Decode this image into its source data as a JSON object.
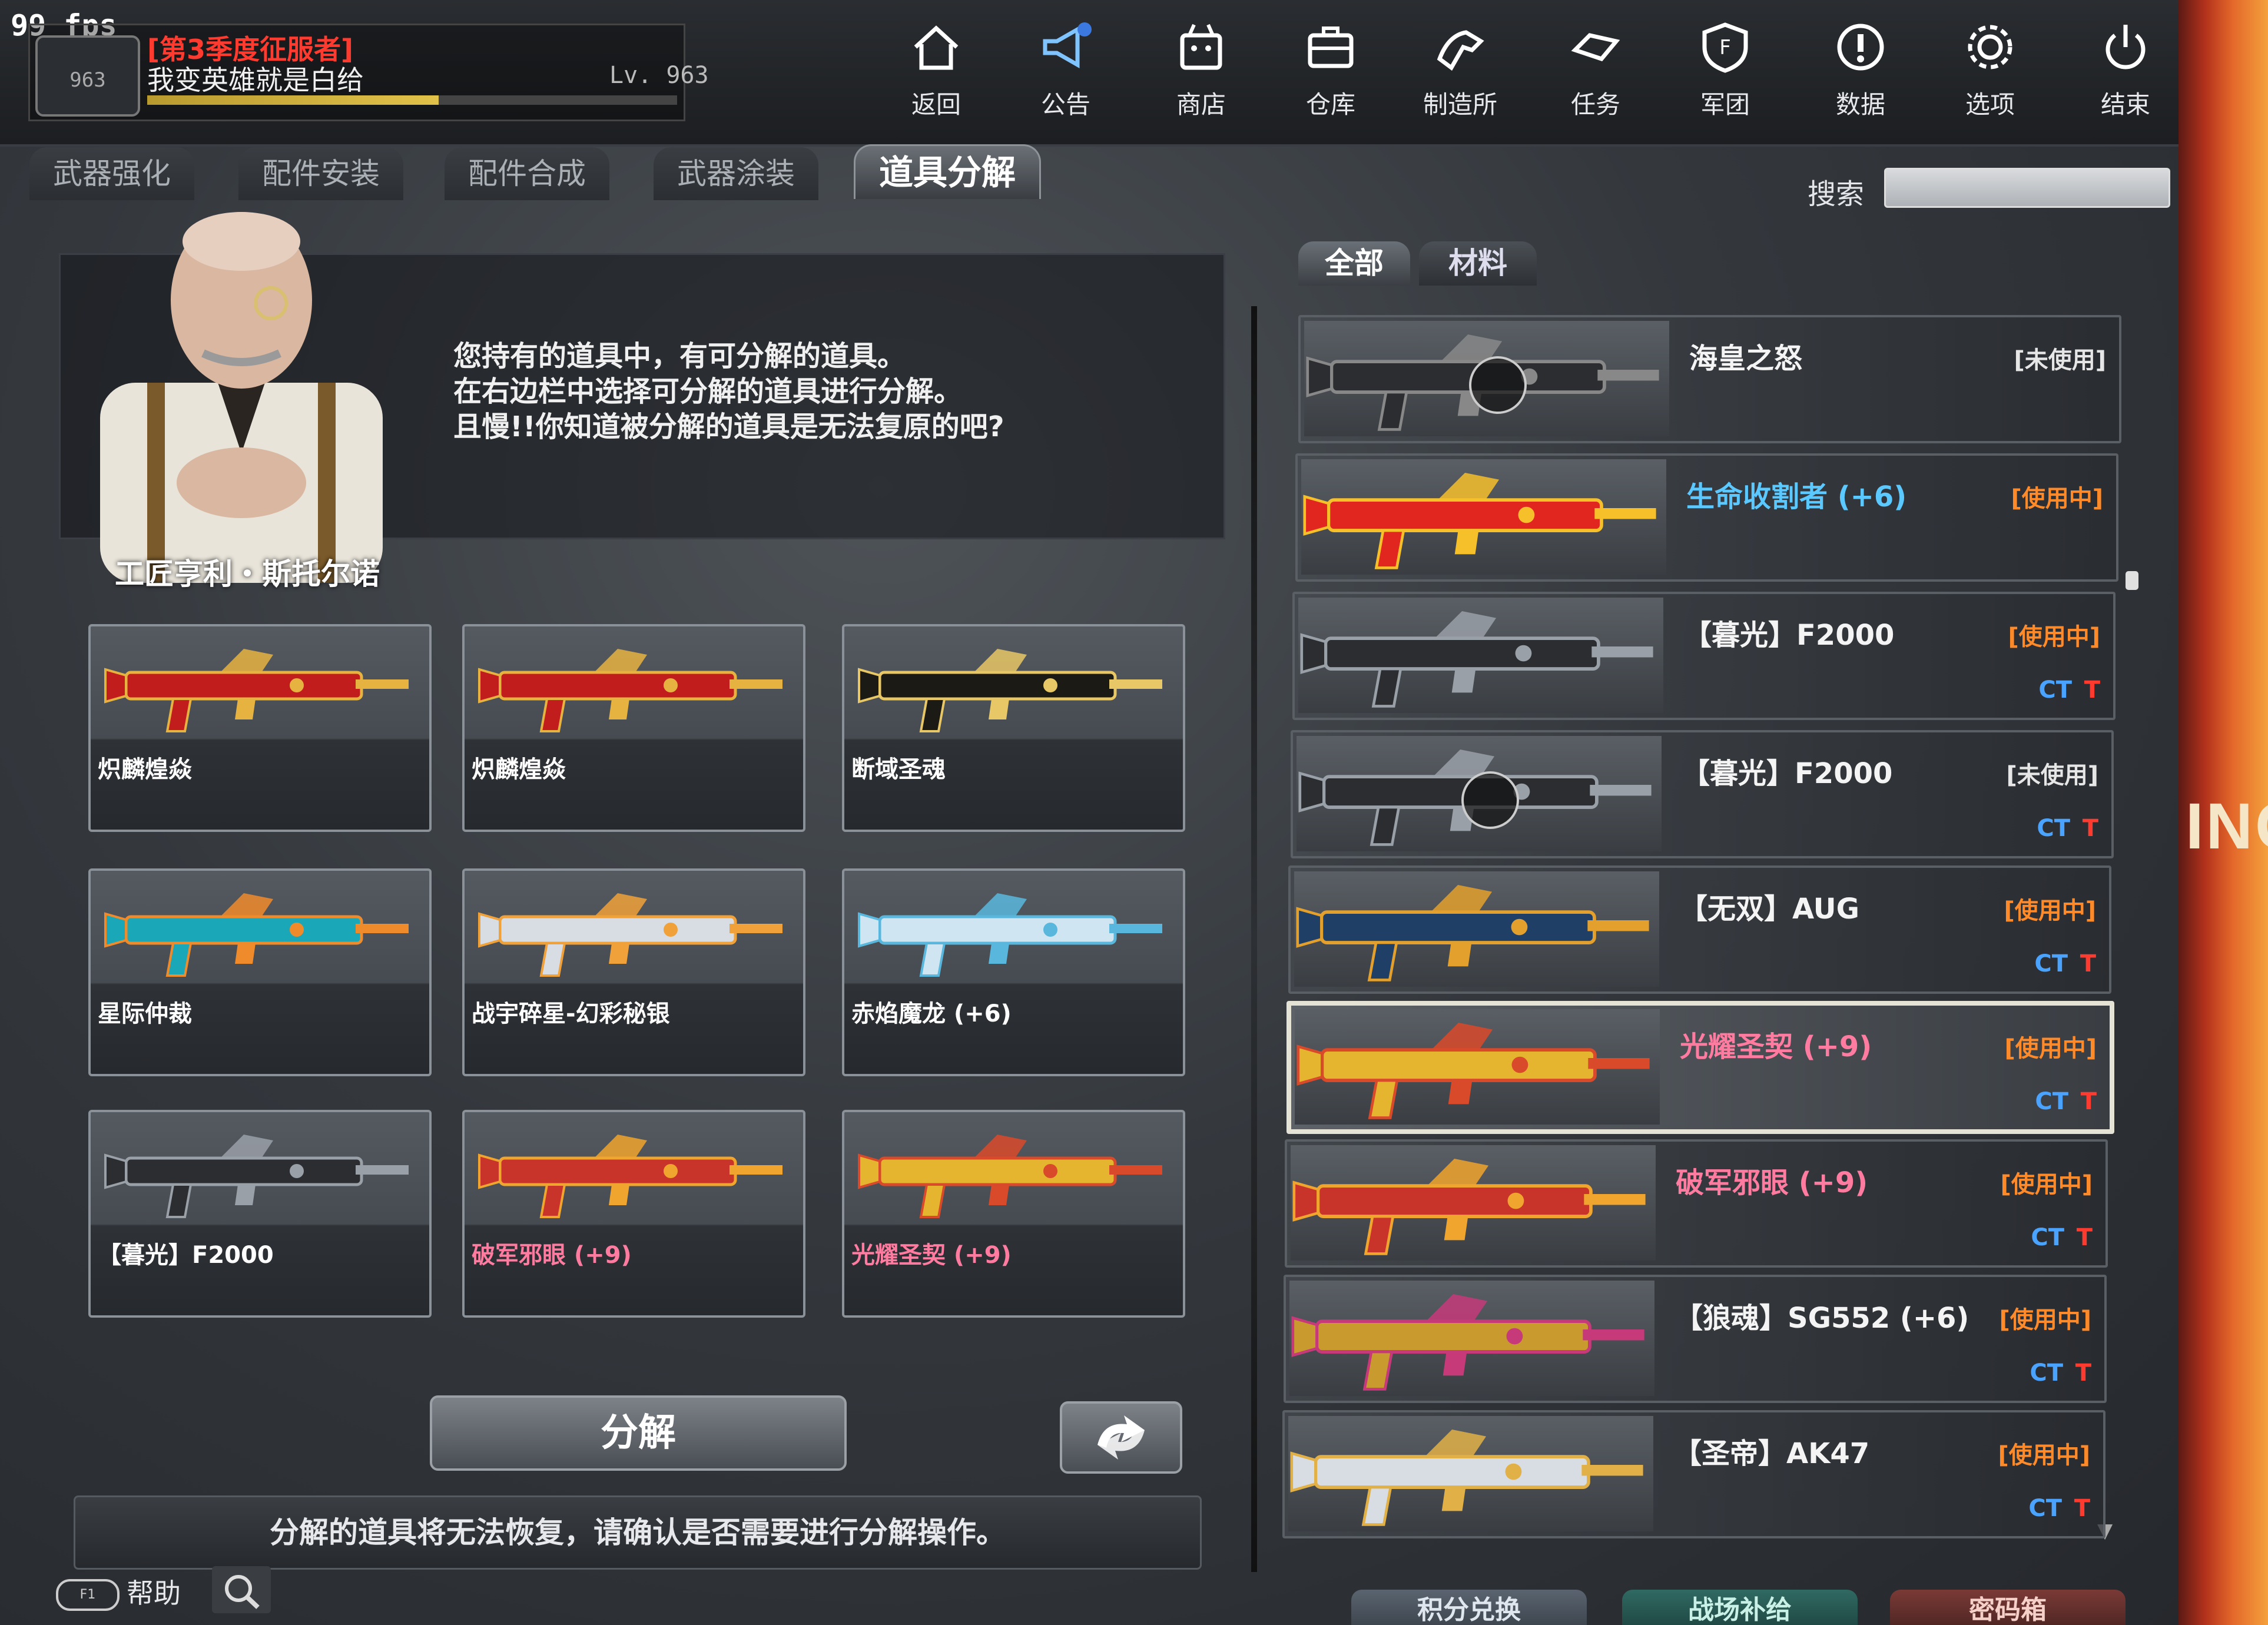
{
  "hud": {
    "fps": "99 fps"
  },
  "profile": {
    "rank_badge": "963",
    "season_title": "[第3季度征服者]",
    "nickname": "我变英雄就是白给",
    "level": "Lv. 963",
    "xp_fraction": 0.55
  },
  "nav": [
    {
      "label": "返回",
      "icon": "home-icon"
    },
    {
      "label": "公告",
      "icon": "megaphone-icon"
    },
    {
      "label": "商店",
      "icon": "shop-icon"
    },
    {
      "label": "仓库",
      "icon": "briefcase-icon"
    },
    {
      "label": "制造所",
      "icon": "crafting-icon"
    },
    {
      "label": "任务",
      "icon": "mission-icon"
    },
    {
      "label": "军团",
      "icon": "shield-icon"
    },
    {
      "label": "数据",
      "icon": "info-icon"
    },
    {
      "label": "选项",
      "icon": "gear-icon"
    },
    {
      "label": "结束",
      "icon": "power-icon"
    }
  ],
  "tabs": [
    "武器强化",
    "配件安装",
    "配件合成",
    "武器涂装",
    "道具分解"
  ],
  "active_tab": "道具分解",
  "search": {
    "label": "搜索",
    "value": ""
  },
  "npc": {
    "name": "工匠亨利・斯托尔诺",
    "dialog": [
      "您持有的道具中，有可分解的道具。",
      "在右边栏中选择可分解的道具进行分解。",
      "且慢!!你知道被分解的道具是无法复原的吧?"
    ]
  },
  "slots": [
    {
      "label": "炽麟煌焱",
      "color": "#c21d1d",
      "accent": "#e6b341"
    },
    {
      "label": "炽麟煌焱",
      "color": "#c21d1d",
      "accent": "#e6b341"
    },
    {
      "label": "断域圣魂",
      "color": "#1c1a14",
      "accent": "#e7c766"
    },
    {
      "label": "星际仲裁",
      "color": "#1aa7b8",
      "accent": "#f08b2c"
    },
    {
      "label": "战宇碎星-幻彩秘银",
      "color": "#d8dde4",
      "accent": "#f0a13a"
    },
    {
      "label": "赤焰魔龙 (+6)",
      "color": "#cfe6f2",
      "accent": "#59b7dd"
    },
    {
      "label": "【暮光】F2000",
      "color": "#2b2d31",
      "accent": "#9aa0a8"
    },
    {
      "label": "破军邪眼 (+9)",
      "color": "#c9342a",
      "accent": "#f0a52e",
      "pink": true
    },
    {
      "label": "光耀圣契 (+9)",
      "color": "#e6b52f",
      "accent": "#d94a2a",
      "pink": true
    }
  ],
  "decompose_button": "分解",
  "warning": "分解的道具将无法恢复，请确认是否需要进行分解操作。",
  "help": {
    "key": "F1",
    "label": "帮助"
  },
  "filters": [
    "全部",
    "材料"
  ],
  "inventory": [
    {
      "name": "海皇之怒",
      "status": "[未使用]",
      "inuse": false,
      "locked": true,
      "ct_t": false,
      "color": "#2b2d31",
      "accent": "#888"
    },
    {
      "name": "生命收割者 (+6)",
      "status": "[使用中]",
      "inuse": true,
      "locked": false,
      "ct_t": false,
      "name_style": "blue",
      "color": "#e0261f",
      "accent": "#f6c02b"
    },
    {
      "name": "【暮光】F2000",
      "status": "[使用中]",
      "inuse": true,
      "locked": false,
      "ct_t": true,
      "color": "#2b2d31",
      "accent": "#9aa0a8"
    },
    {
      "name": "【暮光】F2000",
      "status": "[未使用]",
      "inuse": false,
      "locked": true,
      "ct_t": true,
      "color": "#2b2d31",
      "accent": "#9aa0a8"
    },
    {
      "name": "【无双】AUG",
      "status": "[使用中]",
      "inuse": true,
      "locked": false,
      "ct_t": true,
      "color": "#1f3f66",
      "accent": "#e3a02d"
    },
    {
      "name": "光耀圣契 (+9)",
      "status": "[使用中]",
      "inuse": true,
      "locked": false,
      "ct_t": true,
      "selected": true,
      "name_style": "pink",
      "color": "#e6b52f",
      "accent": "#d94a2a"
    },
    {
      "name": "破军邪眼 (+9)",
      "status": "[使用中]",
      "inuse": true,
      "locked": false,
      "ct_t": true,
      "name_style": "pink",
      "color": "#c9342a",
      "accent": "#f0a52e"
    },
    {
      "name": "【狼魂】SG552 (+6)",
      "status": "[使用中]",
      "inuse": true,
      "locked": false,
      "ct_t": true,
      "color": "#c99a2e",
      "accent": "#c63a7a"
    },
    {
      "name": "【圣帝】AK47",
      "status": "[使用中]",
      "inuse": true,
      "locked": false,
      "ct_t": true,
      "color": "#d8dde4",
      "accent": "#e1b046"
    }
  ],
  "team_tags": {
    "ct": "CT",
    "t": "T"
  },
  "bottom_buttons": [
    "积分兑换",
    "战场补给",
    "密码箱"
  ],
  "edge_text": "INC"
}
